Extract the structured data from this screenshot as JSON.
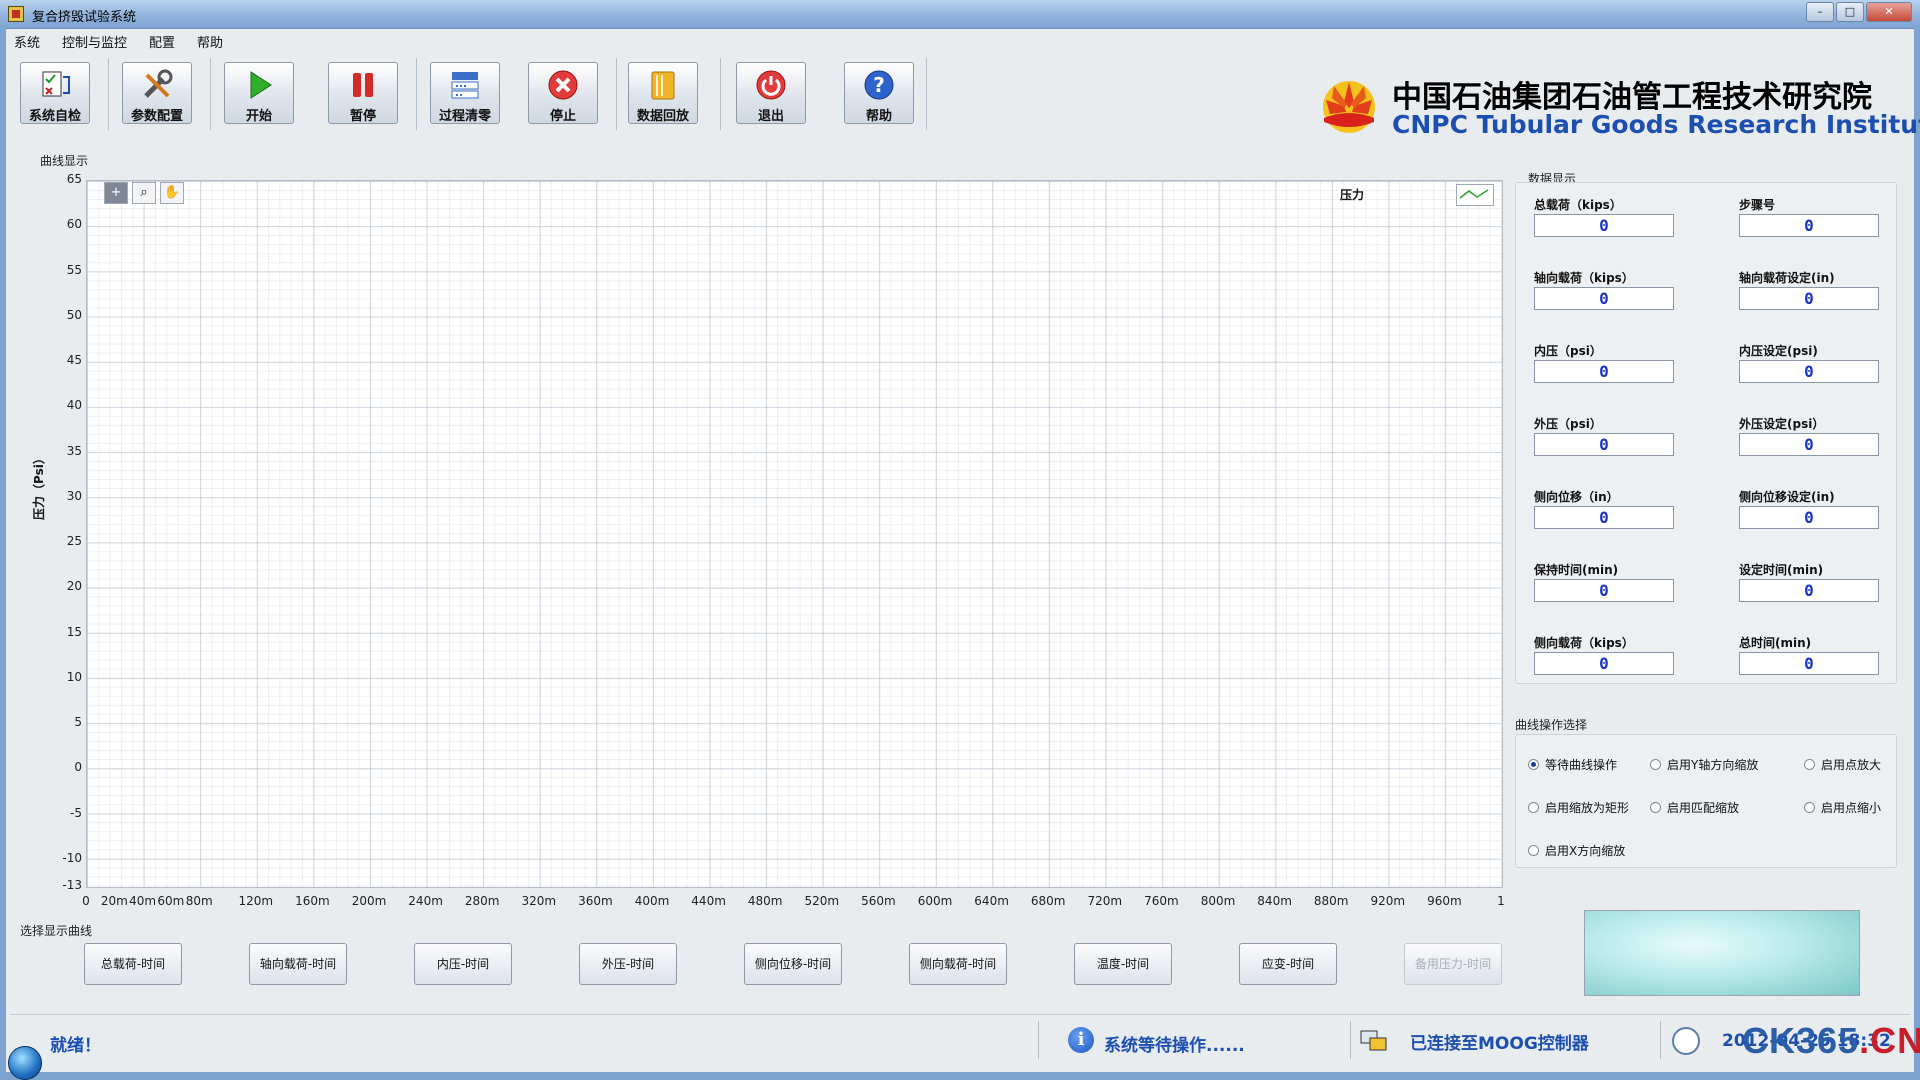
{
  "window": {
    "title": "复合挤毁试验系统"
  },
  "menu": [
    "系统",
    "控制与监控",
    "配置",
    "帮助"
  ],
  "toolbar": {
    "self_check": "系统自检",
    "param_config": "参数配置",
    "start": "开始",
    "pause": "暂停",
    "process_clear": "过程清零",
    "stop": "停止",
    "playback": "数据回放",
    "exit": "退出",
    "help": "帮助"
  },
  "logo": {
    "cn": "中国石油集团石油管工程技术研究院",
    "en": "CNPC Tubular Goods Research Institute"
  },
  "graph": {
    "section_label": "曲线显示",
    "plot_name": "压力",
    "y_label": "压力（Psi）",
    "y_ticks": [
      "65",
      "60",
      "55",
      "50",
      "45",
      "40",
      "35",
      "30",
      "25",
      "20",
      "15",
      "10",
      "5",
      "0",
      "-5",
      "-10",
      "-13"
    ],
    "x_ticks": [
      "0",
      "20m",
      "40m",
      "60m",
      "80m",
      "120m",
      "160m",
      "200m",
      "240m",
      "280m",
      "320m",
      "360m",
      "400m",
      "440m",
      "480m",
      "520m",
      "560m",
      "600m",
      "640m",
      "680m",
      "720m",
      "760m",
      "800m",
      "840m",
      "880m",
      "920m",
      "960m",
      "1"
    ]
  },
  "data_display": {
    "label": "数据显示",
    "fields": [
      {
        "label": "总载荷（kips）",
        "value": "0"
      },
      {
        "label": "步骤号",
        "value": "0"
      },
      {
        "label": "轴向载荷（kips）",
        "value": "0"
      },
      {
        "label": "轴向载荷设定(in)",
        "value": "0"
      },
      {
        "label": "内压（psi）",
        "value": "0"
      },
      {
        "label": "内压设定(psi)",
        "value": "0"
      },
      {
        "label": "外压（psi）",
        "value": "0"
      },
      {
        "label": "外压设定(psi）",
        "value": "0"
      },
      {
        "label": "侧向位移（in）",
        "value": "0"
      },
      {
        "label": "侧向位移设定(in)",
        "value": "0"
      },
      {
        "label": "保持时间(min)",
        "value": "0"
      },
      {
        "label": "设定时间(min)",
        "value": "0"
      },
      {
        "label": "侧向载荷（kips）",
        "value": "0"
      },
      {
        "label": "总时间(min)",
        "value": "0"
      }
    ]
  },
  "curve_ops": {
    "label": "曲线操作选择",
    "options": [
      "等待曲线操作",
      "启用Y轴方向缩放",
      "启用点放大",
      "启用缩放为矩形",
      "启用匹配缩放",
      "启用点缩小",
      "启用X方向缩放"
    ],
    "selected": "等待曲线操作"
  },
  "curve_select": {
    "label": "选择显示曲线",
    "buttons": [
      "总载荷-时间",
      "轴向载荷-时间",
      "内压-时间",
      "外压-时间",
      "侧向位移-时间",
      "侧向载荷-时间",
      "温度-时间",
      "应变-时间",
      "备用压力-时间"
    ]
  },
  "status": {
    "ready": "就绪！",
    "system": "系统等待操作......",
    "connection": "已连接至MOOG控制器",
    "datetime": "2012-04-25 18:32"
  },
  "watermark": {
    "prefix": "CK365",
    "suffix": ".CN"
  }
}
